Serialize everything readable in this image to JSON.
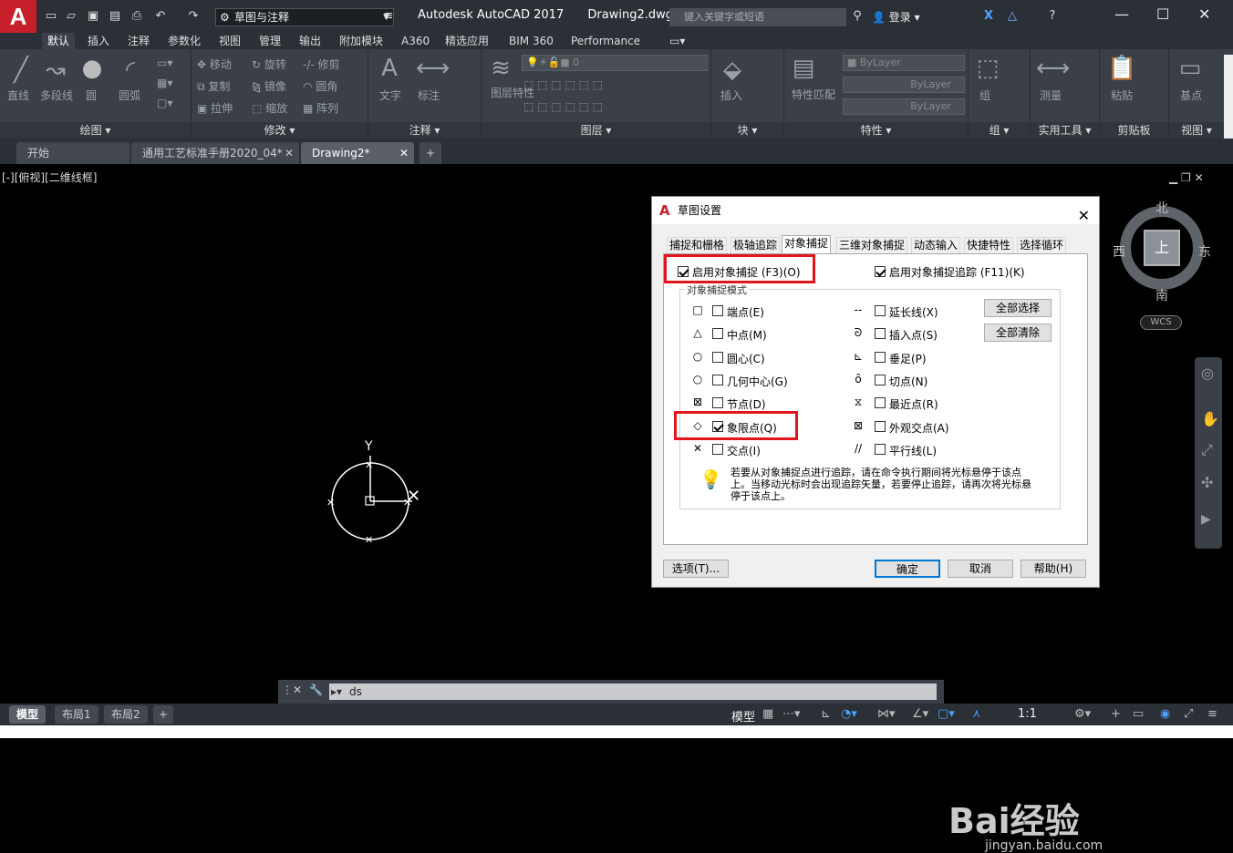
{
  "titlebar": {
    "workspace": "草图与注释",
    "app_name": "Autodesk AutoCAD 2017",
    "doc_name": "Drawing2.dwg",
    "search_placeholder": "键入关键字或短语",
    "login": "登录"
  },
  "menubar": [
    "默认",
    "插入",
    "注释",
    "参数化",
    "视图",
    "管理",
    "输出",
    "附加模块",
    "A360",
    "精选应用",
    "BIM 360",
    "Performance"
  ],
  "ribbon": {
    "draw": {
      "title": "绘图 ▾",
      "tools": [
        "直线",
        "多段线",
        "圆",
        "圆弧"
      ]
    },
    "modify": {
      "title": "修改 ▾",
      "tools": [
        "移动",
        "旋转",
        "修剪",
        "复制",
        "镜像",
        "圆角",
        "拉伸",
        "缩放",
        "阵列"
      ]
    },
    "annotation": {
      "title": "注释 ▾",
      "tools": [
        "文字",
        "标注"
      ]
    },
    "layers": {
      "title": "图层 ▾",
      "tool": "图层特性",
      "current_layer": "0"
    },
    "block": {
      "title": "块 ▾",
      "tool": "插入"
    },
    "properties": {
      "title": "特性 ▾",
      "tool": "特性匹配",
      "color": "ByLayer",
      "linetype": "ByLayer",
      "lineweight": "ByLayer"
    },
    "groups": {
      "title": "组 ▾",
      "tool": "组"
    },
    "utilities": {
      "title": "实用工具 ▾",
      "tool": "测量"
    },
    "clipboard": {
      "title": "剪贴板",
      "tool": "粘贴"
    },
    "view": {
      "title": "视图 ▾",
      "tool": "基点"
    }
  },
  "doctabs": [
    "开始",
    "通用工艺标准手册2020_04*",
    "Drawing2*"
  ],
  "viewport_label": "[-][俯视][二维线框]",
  "viewcube": {
    "north": "北",
    "south": "南",
    "east": "东",
    "west": "西",
    "top": "上",
    "wcs": "WCS"
  },
  "drawing": {
    "y_label": "Y"
  },
  "dialog": {
    "title": "草图设置",
    "tabs": [
      "捕捉和栅格",
      "极轴追踪",
      "对象捕捉",
      "三维对象捕捉",
      "动态输入",
      "快捷特性",
      "选择循环"
    ],
    "enable_osnap": "启用对象捕捉 (F3)(O)",
    "enable_osnap_tracking": "启用对象捕捉追踪 (F11)(K)",
    "group_title": "对象捕捉模式",
    "modes_left": [
      {
        "label": "端点(E)",
        "checked": false,
        "symbol": "□"
      },
      {
        "label": "中点(M)",
        "checked": false,
        "symbol": "△"
      },
      {
        "label": "圆心(C)",
        "checked": false,
        "symbol": "○"
      },
      {
        "label": "几何中心(G)",
        "checked": false,
        "symbol": "○"
      },
      {
        "label": "节点(D)",
        "checked": false,
        "symbol": "⊠"
      },
      {
        "label": "象限点(Q)",
        "checked": true,
        "symbol": "◇"
      },
      {
        "label": "交点(I)",
        "checked": false,
        "symbol": "✕"
      }
    ],
    "modes_right": [
      {
        "label": "延长线(X)",
        "checked": false,
        "symbol": "--"
      },
      {
        "label": "插入点(S)",
        "checked": false,
        "symbol": "ᘐ"
      },
      {
        "label": "垂足(P)",
        "checked": false,
        "symbol": "⊾"
      },
      {
        "label": "切点(N)",
        "checked": false,
        "symbol": "ȏ"
      },
      {
        "label": "最近点(R)",
        "checked": false,
        "symbol": "⧖"
      },
      {
        "label": "外观交点(A)",
        "checked": false,
        "symbol": "⊠"
      },
      {
        "label": "平行线(L)",
        "checked": false,
        "symbol": "//"
      }
    ],
    "select_all": "全部选择",
    "clear_all": "全部清除",
    "hint": "若要从对象捕捉点进行追踪，请在命令执行期间将光标悬停于该点上。当移动光标时会出现追踪矢量，若要停止追踪，请再次将光标悬停于该点上。",
    "options": "选项(T)...",
    "ok": "确定",
    "cancel": "取消",
    "help": "帮助(H)"
  },
  "command_line": {
    "value": "ds"
  },
  "layout_tabs": [
    "模型",
    "布局1",
    "布局2"
  ],
  "status": {
    "model": "模型",
    "scale": "1:1"
  },
  "watermark": {
    "brand": "Bai经验",
    "url": "jingyan.baidu.com"
  },
  "accent_color": "#e3151b"
}
